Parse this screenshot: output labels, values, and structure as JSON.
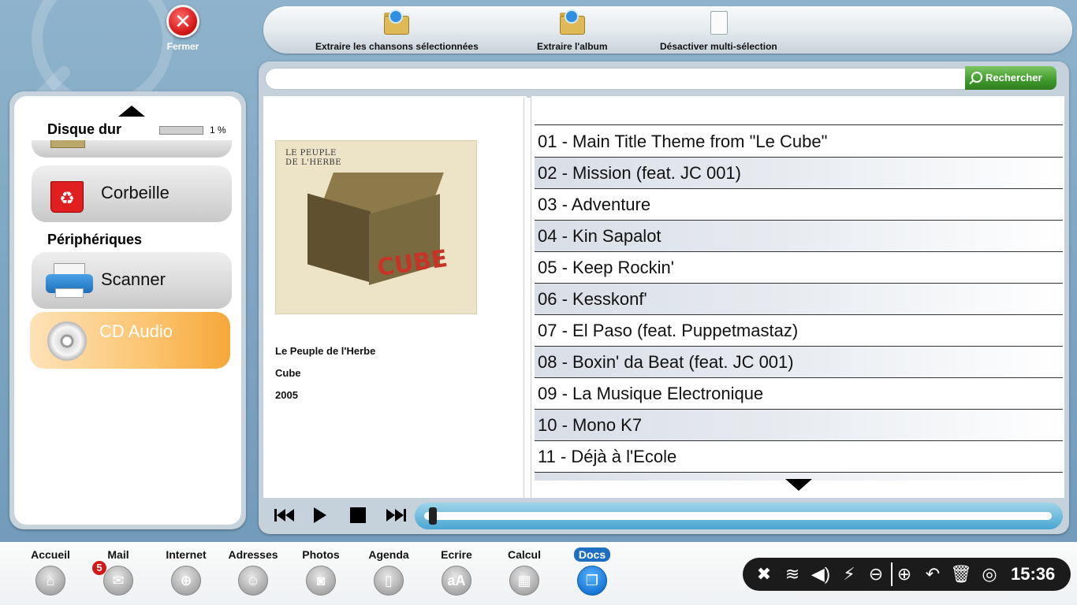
{
  "close_label": "Fermer",
  "toolbar": {
    "extract_selected": "Extraire les chansons sélectionnées",
    "extract_album": "Extraire l'album",
    "disable_multiselect": "Désactiver multi-sélection"
  },
  "sidebar": {
    "hard_disk_title": "Disque dur",
    "hard_disk_usage": "1 %",
    "hard_disk_usage_fraction": 0.01,
    "trash_label": "Corbeille",
    "devices_title": "Périphériques",
    "scanner_label": "Scanner",
    "cd_label": "CD Audio"
  },
  "search": {
    "value": "",
    "button_label": "Rechercher"
  },
  "album": {
    "cover_text": "LE PEUPLE\nDE L'HERBE",
    "cover_logo": "CUBE",
    "artist": "Le Peuple de l'Herbe",
    "title": "Cube",
    "year": "2005"
  },
  "tracks": [
    "01 - Main Title Theme from \"Le Cube\"",
    "02 - Mission (feat. JC 001)",
    "03 - Adventure",
    "04 - Kin Sapalot",
    "05 - Keep Rockin'",
    "06 - Kesskonf'",
    "07 - El Paso (feat. Puppetmastaz)",
    "08 - Boxin' da Beat (feat. JC 001)",
    "09 - La Musique Electronique",
    "10 - Mono K7",
    "11 - Déjà à l'Ecole"
  ],
  "player": {
    "progress_fraction": 0.0
  },
  "bottom_apps": {
    "accueil": "Accueil",
    "mail": "Mail",
    "mail_badge": "5",
    "internet": "Internet",
    "adresses": "Adresses",
    "photos": "Photos",
    "agenda": "Agenda",
    "ecrire": "Ecrire",
    "ecrire_icon_text": "aA",
    "calcul": "Calcul",
    "docs": "Docs"
  },
  "tray": {
    "clock": "15:36",
    "icons": [
      "tools-icon",
      "wifi-icon",
      "volume-icon",
      "battery-icon",
      "zoom-out-icon",
      "zoom-in-icon",
      "undo-icon",
      "trash-icon",
      "help-icon"
    ]
  },
  "colors": {
    "accent_orange": "#f6a73a",
    "search_green": "#3f9a2c",
    "docs_blue": "#1677d6",
    "progress_blue": "#4aa6d3",
    "close_red": "#d81c1c"
  }
}
